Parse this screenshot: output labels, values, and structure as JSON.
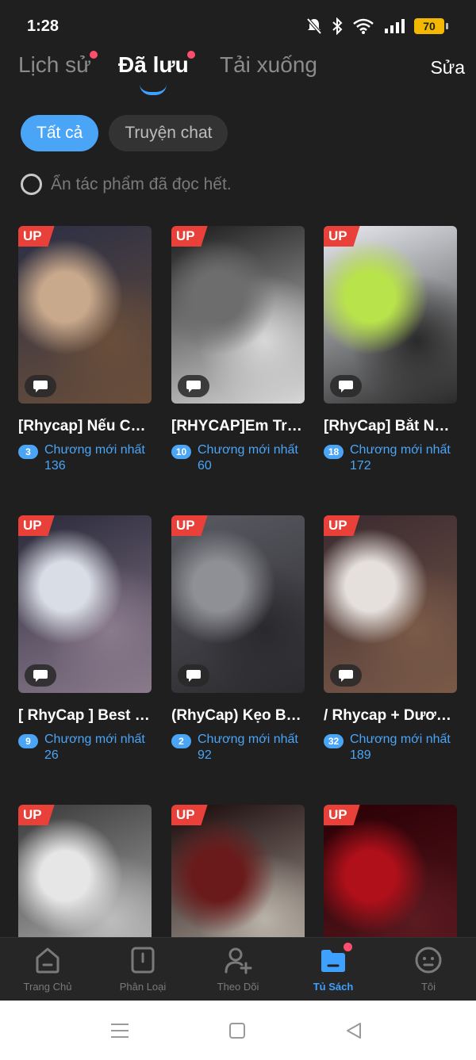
{
  "status": {
    "time": "1:28",
    "battery": "70"
  },
  "top_tabs": [
    {
      "label": "Lịch sử",
      "has_dot": true
    },
    {
      "label": "Đã lưu",
      "has_dot": true,
      "active": true
    },
    {
      "label": "Tải xuống",
      "has_dot": false
    }
  ],
  "edit_label": "Sửa",
  "chips": [
    {
      "label": "Tất cả",
      "active": true
    },
    {
      "label": "Truyện chat",
      "active": false
    }
  ],
  "hide_read_label": "Ẩn tác phẩm đã đọc hết.",
  "badge_up": "UP",
  "latest_chapter_label": "Chương mới nhất",
  "stories": [
    {
      "title": "[Rhycap] Nếu Có...",
      "count": "3",
      "chapter": "136",
      "colors": [
        "#2b2f45",
        "#c9a98c",
        "#6a4e3a"
      ]
    },
    {
      "title": "[RHYCAP]Em Tra...",
      "count": "10",
      "chapter": "60",
      "colors": [
        "#1a1a1a",
        "#6d6d6d",
        "#d8d8d8"
      ]
    },
    {
      "title": "[RhyCap] Bắt Nạt...",
      "count": "18",
      "chapter": "172",
      "colors": [
        "#e8eaf0",
        "#b9e34a",
        "#2a2a2a"
      ]
    },
    {
      "title": "[ RhyCap ] Best F...",
      "count": "9",
      "chapter": "26",
      "colors": [
        "#2a2a3a",
        "#d9dde6",
        "#8a7a8c"
      ]
    },
    {
      "title": "(RhyCap) Kẹo Bô...",
      "count": "2",
      "chapter": "92",
      "colors": [
        "#5a5a62",
        "#8f8f96",
        "#2a2a2e"
      ]
    },
    {
      "title": "/ Rhycap + Dươn...",
      "count": "32",
      "chapter": "189",
      "colors": [
        "#3a2a30",
        "#e5e0dc",
        "#7a5a48"
      ]
    },
    {
      "title": "",
      "count": "",
      "chapter": "",
      "colors": [
        "#3a3a3a",
        "#e6e6e6",
        "#bdbdbd"
      ]
    },
    {
      "title": "",
      "count": "",
      "chapter": "",
      "colors": [
        "#1a0a0a",
        "#6a1a1a",
        "#b9b2a8"
      ]
    },
    {
      "title": "",
      "count": "",
      "chapter": "",
      "colors": [
        "#2a0005",
        "#b0101a",
        "#5a1a20"
      ]
    }
  ],
  "bottom_nav": [
    {
      "label": "Trang Chủ",
      "icon": "home-icon"
    },
    {
      "label": "Phân Loại",
      "icon": "category-icon"
    },
    {
      "label": "Theo Dõi",
      "icon": "follow-icon"
    },
    {
      "label": "Tủ Sách",
      "icon": "bookshelf-icon",
      "active": true
    },
    {
      "label": "Tôi",
      "icon": "profile-icon"
    }
  ],
  "accent_color": "#3ea0ff",
  "badge_color": "#e9413a"
}
